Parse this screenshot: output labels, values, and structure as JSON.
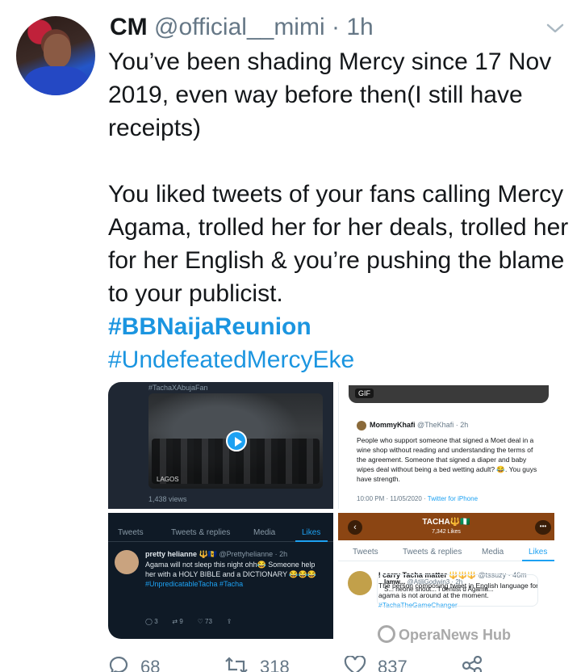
{
  "author": {
    "name": "CM",
    "handle": "@official__mimi",
    "separator": "·",
    "time": "1h"
  },
  "tweet": {
    "paragraph1": "You’ve been shading Mercy since 17 Nov 2019, even way before then(I still have receipts)",
    "paragraph2": "You liked tweets of your fans calling Mercy Agama, trolled her for her deals, trolled her for her English & you’re pushing the blame to your publicist.",
    "hashtag1": "#BBNaijaReunion",
    "hashtag2": "#UndefeatedMercyEke"
  },
  "media": {
    "tile1": {
      "top_caption": "#TachaXAbujaFan",
      "tag": "LAGOS",
      "views": "1,438 views"
    },
    "tile2": {
      "gif_label": "GIF",
      "author_name": "MommyKhafi",
      "author_handle": "@TheKhafi · 2h",
      "body": "People who support someone that signed a Moet deal in a wine shop without reading and understanding the terms of the agreement. Someone that signed a diaper and baby wipes deal without being a bed wetting adult? 😂. You guys have strength.",
      "timestamp": "10:00 PM · 11/05/2020 ·",
      "client": "Twitter for iPhone"
    },
    "tile3": {
      "tabs": [
        "Tweets",
        "Tweets & replies",
        "Media",
        "Likes"
      ],
      "author_name": "pretty helianne 🔱🇧🇧",
      "author_handle": "@Prettyhelianne · 2h",
      "body": "Agama will not sleep this night ohh😂 Someone help her with a HOLY BIBLE and a DICTIONARY 😂😂😂",
      "tags": "#UnpredicatableTacha #Tacha",
      "replies": "3",
      "retweets": "9",
      "likes": "73"
    },
    "tile4": {
      "profile_title": "TACHA🔱🇳🇬",
      "profile_likes": "7,342 Likes",
      "tabs": [
        "Tweets",
        "Tweets & replies",
        "Media",
        "Likes"
      ],
      "author_name": "I carry Tacha matter 🔱🔱🔱",
      "author_handle": "@tssuzy · 46m",
      "body": "The person composing tweet in English language for agama is not around at the moment.",
      "tags": "#TachaTheGameChanger",
      "quote_author": "Iamw...",
      "quote_handle": "@AtiliGodwin3 · 2h",
      "quote_text": "S... neone shout... I dentist d Agama..."
    }
  },
  "actions": {
    "replies": "68",
    "retweets": "318",
    "likes": "837"
  },
  "watermark": "OperaNews Hub",
  "colors": {
    "link": "#1b95e0",
    "text": "#14171a",
    "muted": "#657786"
  }
}
